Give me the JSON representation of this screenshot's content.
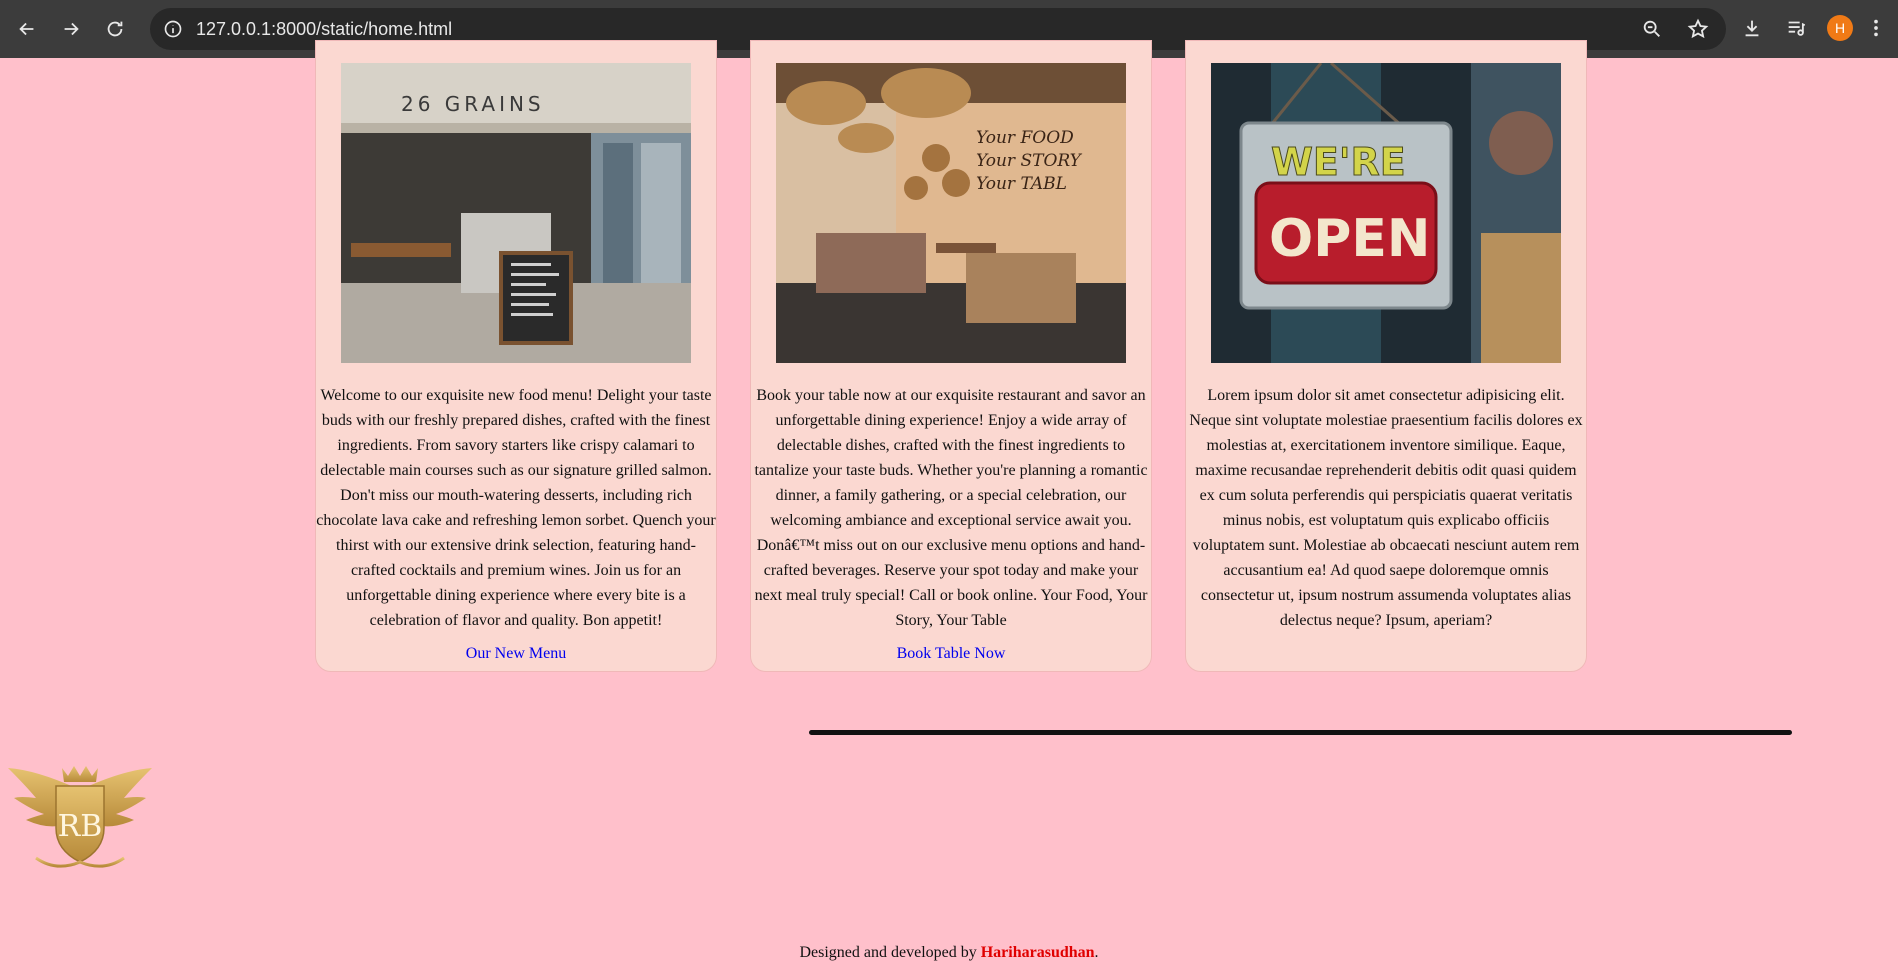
{
  "browser": {
    "url": "127.0.0.1:8000/static/home.html",
    "profile_initial": "H"
  },
  "cards": [
    {
      "text": "Welcome to our exquisite new food menu! Delight your taste buds with our freshly prepared dishes, crafted with the finest ingredients. From savory starters like crispy calamari to delectable main courses such as our signature grilled salmon. Don't miss our mouth-watering desserts, including rich chocolate lava cake and refreshing lemon sorbet. Quench your thirst with our extensive drink selection, featuring hand-crafted cocktails and premium wines. Join us for an unforgettable dining experience where every bite is a celebration of flavor and quality. Bon appetit!",
      "link": "Our New Menu",
      "image_sign": "26 GRAINS"
    },
    {
      "text": "Book your table now at our exquisite restaurant and savor an unforgettable dining experience! Enjoy a wide array of delectable dishes, crafted with the finest ingredients to tantalize your taste buds. Whether you're planning a romantic dinner, a family gathering, or a special celebration, our welcoming ambiance and exceptional service await you. Donâ€™t miss out on our exclusive menu options and hand-crafted beverages. Reserve your spot today and make your next meal truly special! Call or book online. Your Food, Your Story, Your Table",
      "link": "Book Table Now",
      "image_wall_lines": [
        "Your FOOD",
        "Your STORY",
        "Your TABL"
      ]
    },
    {
      "text": "Lorem ipsum dolor sit amet consectetur adipisicing elit. Neque sint voluptate molestiae praesentium facilis dolores ex molestias at, exercitationem inventore similique. Eaque, maxime recusandae reprehenderit debitis odit quasi quidem ex cum soluta perferendis qui perspiciatis quaerat veritatis minus nobis, est voluptatum quis explicabo officiis voluptatem sunt. Molestiae ab obcaecati nesciunt autem rem accusantium ea! Ad quod saepe doloremque omnis consectetur ut, ipsum nostrum assumenda voluptates alias delectus neque? Ipsum, aperiam?",
      "link": "",
      "image_sign_lines": [
        "WE'RE",
        "OPEN"
      ]
    }
  ],
  "logo": {
    "monogram": "RB"
  },
  "footer": {
    "prefix": "Designed and developed by ",
    "author": "Hariharasudhan",
    "suffix": "."
  },
  "colors": {
    "page_bg": "#ffc0cb",
    "card_bg": "#fbd8d1",
    "link": "#0000ee",
    "author": "#e00000"
  }
}
